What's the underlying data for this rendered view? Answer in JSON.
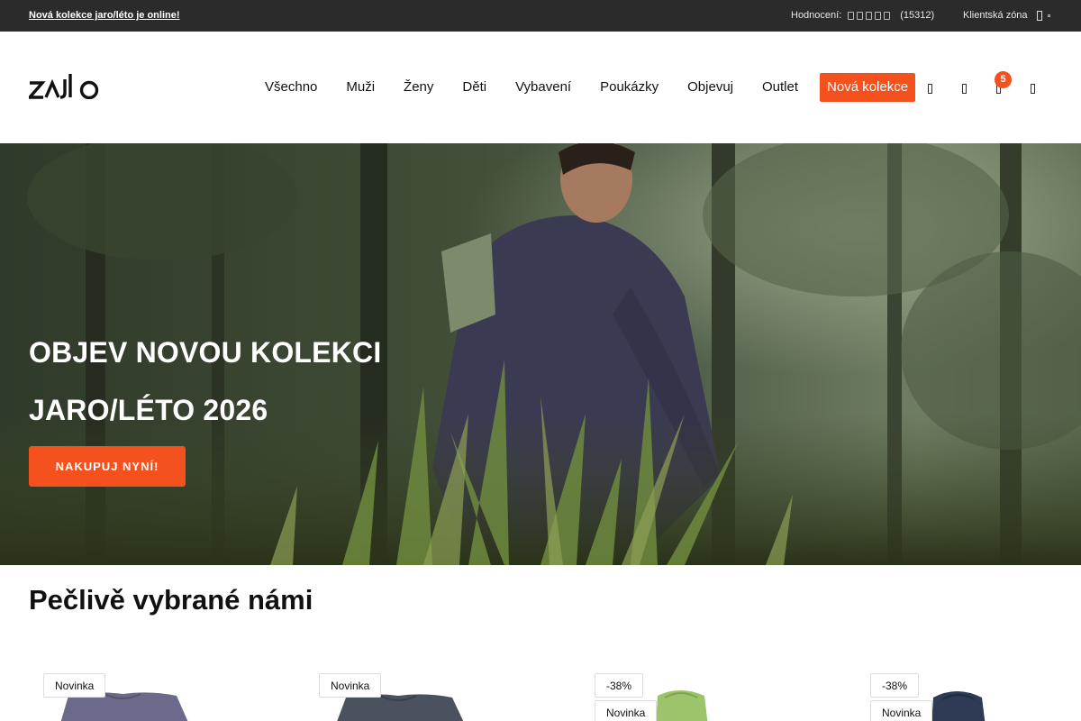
{
  "topbar": {
    "promo": "Nová kolekce jaro/léto je online!",
    "rating_label": "Hodnocení:",
    "rating_count": "(15312)",
    "client_zone": "Klientská zóna"
  },
  "header": {
    "logo_text": "ZAJO",
    "nav": [
      "Všechno",
      "Muži",
      "Ženy",
      "Děti",
      "Vybavení",
      "Poukázky",
      "Objevuj",
      "Outlet",
      "Nová kolekce"
    ],
    "cart_count": "5",
    "icons": [
      "search-icon",
      "user-icon",
      "cart-icon",
      "menu-icon"
    ]
  },
  "hero": {
    "title_line1": "OBJEV NOVOU KOLEKCI",
    "title_line2": "JARO/LÉTO 2026",
    "cta": "NAKUPUJ NYNÍ!"
  },
  "section": {
    "title": "Pečlivě vybrané námi"
  },
  "products": [
    {
      "tags": [
        "Novinka"
      ],
      "color": "#6b6a8a"
    },
    {
      "tags": [
        "Novinka"
      ],
      "color": "#4a5260"
    },
    {
      "tags": [
        "-38%",
        "Novinka"
      ],
      "color": "#9cc46a"
    },
    {
      "tags": [
        "-38%",
        "Novinka"
      ],
      "color": "#2f3a55"
    }
  ],
  "colors": {
    "accent": "#f4511e",
    "topbar_bg": "#2b2b2b"
  }
}
